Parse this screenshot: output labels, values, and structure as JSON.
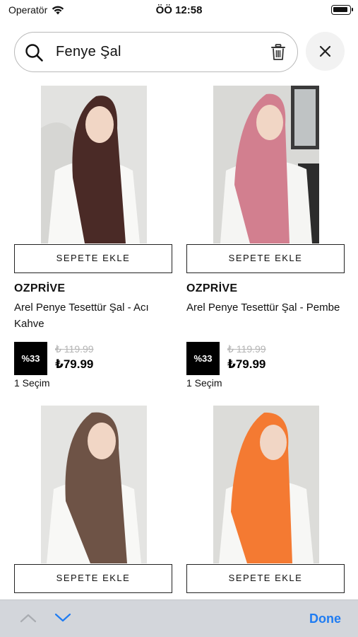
{
  "status_bar": {
    "carrier": "Operatör",
    "time": "ÖÖ 12:58"
  },
  "search": {
    "query": "Fenye Şal"
  },
  "products": [
    {
      "add_label": "SEPETE EKLE",
      "brand": "OZPRİVE",
      "name": "Arel Penye Tesettür Şal - Acı Kahve",
      "discount": "%33",
      "old_price": "₺ 119.99",
      "new_price": "₺79.99",
      "selection": "1 Seçim",
      "color": "#4a2a26"
    },
    {
      "add_label": "SEPETE EKLE",
      "brand": "OZPRİVE",
      "name": "Arel Penye Tesettür Şal - Pembe",
      "discount": "%33",
      "old_price": "₺ 119.99",
      "new_price": "₺79.99",
      "selection": "1 Seçim",
      "color": "#d27f8f"
    },
    {
      "add_label": "SEPETE EKLE",
      "color": "#6e5346"
    },
    {
      "add_label": "SEPETE EKLE",
      "color": "#f47a32"
    }
  ],
  "toolbar": {
    "done_label": "Done"
  }
}
